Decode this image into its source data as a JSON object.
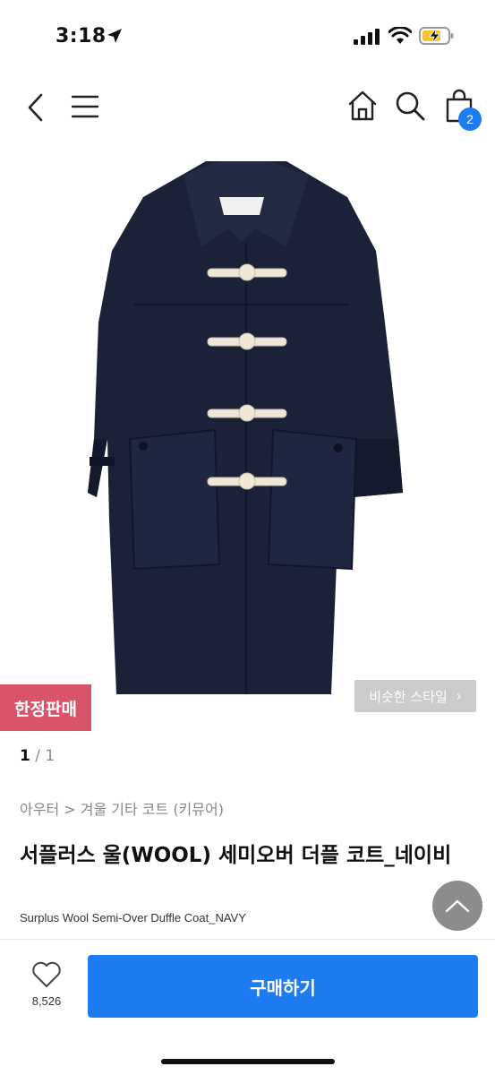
{
  "status_bar": {
    "time": "3:18",
    "icons": [
      "location-arrow-icon",
      "signal-icon",
      "wifi-icon",
      "battery-charging-icon"
    ]
  },
  "nav": {
    "icons": [
      "back-icon",
      "menu-icon",
      "home-icon",
      "search-icon",
      "shopping-bag-icon"
    ],
    "cart_count": "2",
    "badge_color": "#1e7cf2"
  },
  "product": {
    "image_alt_colors": {
      "coat": "#1b2237",
      "toggles": "#efe8d6"
    },
    "limited_badge": "한정판매",
    "limited_badge_color": "#d9536b",
    "similar_style_label": "비슷한 스타일",
    "pager": {
      "current": "1",
      "separator": "/",
      "total": "1"
    },
    "breadcrumb": "아우터 > 겨울 기타 코트 (키뮤어)",
    "title": "서플러스 울(WOOL) 세미오버 더플 코트_네이비",
    "subtitle": "Surplus Wool Semi-Over Duffle Coat_NAVY"
  },
  "bottom_bar": {
    "like_count": "8,526",
    "buy_label": "구매하기",
    "buy_color": "#1e7cf2"
  }
}
